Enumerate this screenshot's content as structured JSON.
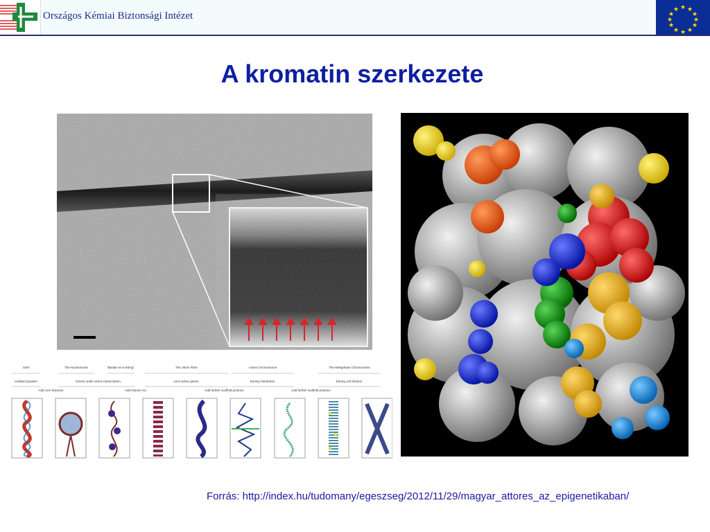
{
  "header": {
    "organization": "Országos Kémiai Biztonsági Intézet"
  },
  "slide": {
    "title": "A kromatin szerkezete",
    "source": "Forrás: http://index.hu/tudomany/egeszseg/2012/11/29/magyar_attores_az_epigenetikaban/"
  },
  "diagram": {
    "stages": [
      "DNA",
      "The Nucleosome",
      "\"Beads-on-a-String\"",
      "The 30nm Fibre",
      "Active Chromosome",
      "The Metaphase Chromosome"
    ],
    "descriptions": [
      "Isolated putative.",
      "Genes under active transcription.",
      "Less active genes.",
      "During interphase.",
      "During cell division."
    ],
    "steps": [
      "Add core histones.",
      "Add histone H1.",
      "Add further scaffold proteins.",
      "Add further scaffold proteins."
    ]
  },
  "colors": {
    "title": "#0f1fa0",
    "header_text": "#1a2a8a",
    "eu_blue": "#0b2d96",
    "eu_star": "#ffdd00",
    "logo_green": "#1e8a3c",
    "logo_red": "#d6242a"
  }
}
